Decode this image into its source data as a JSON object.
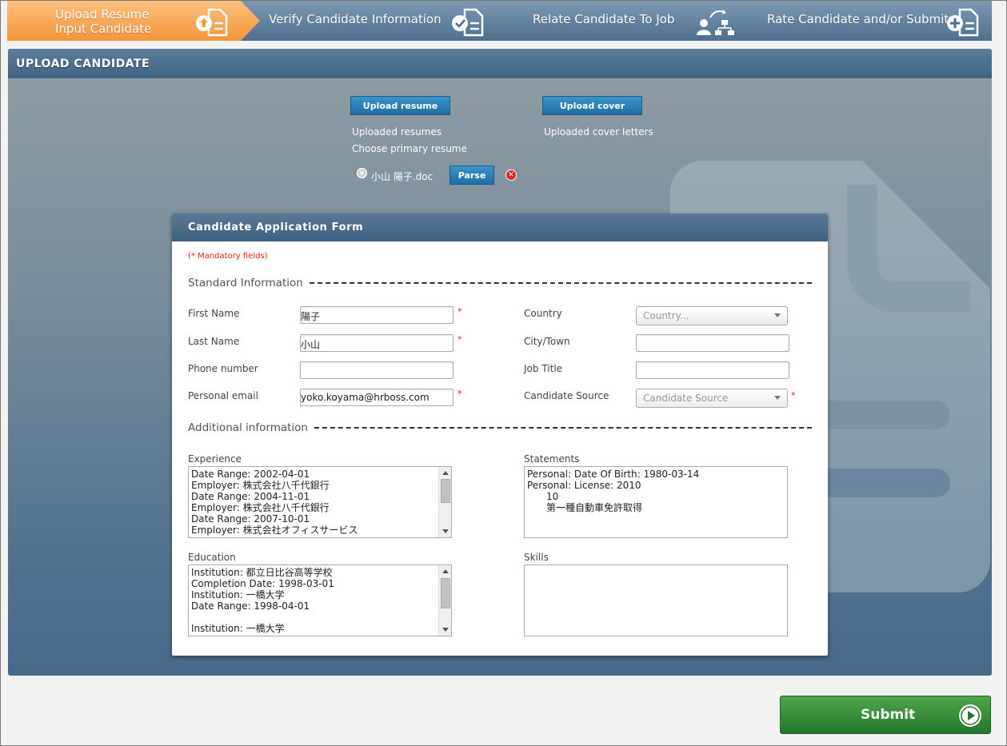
{
  "wizard": {
    "steps": [
      {
        "line1": "Upload Resume",
        "line2": "Input Candidate",
        "icon": "upload-document-icon",
        "active": true
      },
      {
        "line1": "Verify Candidate Information",
        "icon": "check-document-icon",
        "active": false
      },
      {
        "line1": "Relate Candidate To Job",
        "icon": "person-org-chart-icon",
        "active": false
      },
      {
        "line1": "Rate Candidate and/or Submit",
        "icon": "add-document-icon",
        "active": false
      }
    ]
  },
  "panel": {
    "title": "UPLOAD CANDIDATE",
    "upload_resume_button": "Upload resume",
    "upload_cover_button": "Upload cover",
    "uploaded_resumes_label": "Uploaded resumes",
    "choose_primary_label": "Choose primary resume",
    "uploaded_cover_label": "Uploaded cover letters",
    "resume_file": "小山 陽子.doc",
    "parse_button": "Parse",
    "remove_symbol": "✕"
  },
  "form": {
    "title": "Candidate Application Form",
    "mandatory_note": "(* Mandatory fields)",
    "required_mark": "*",
    "standard_section": "Standard Information",
    "additional_section": "Additional information",
    "fields": {
      "first_name": {
        "label": "First Name",
        "value": "陽子"
      },
      "last_name": {
        "label": "Last Name",
        "value": "小山"
      },
      "phone": {
        "label": "Phone number",
        "value": ""
      },
      "email": {
        "label": "Personal email",
        "value": "yoko.koyama@hrboss.com"
      },
      "country": {
        "label": "Country",
        "value": "Country..."
      },
      "city": {
        "label": "City/Town",
        "value": ""
      },
      "job_title": {
        "label": "Job Title",
        "value": ""
      },
      "source": {
        "label": "Candidate Source",
        "value": "Candidate Source"
      }
    },
    "experience": {
      "label": "Experience",
      "lines": [
        "Date Range: 2002-04-01",
        "Employer: 株式会社八千代銀行",
        "Date Range: 2004-11-01",
        "Employer: 株式会社八千代銀行",
        "Date Range: 2007-10-01",
        "Employer: 株式会社オフィスサービス"
      ]
    },
    "statements": {
      "label": "Statements",
      "lines": [
        "Personal: Date Of Birth: 1980-03-14",
        "Personal: License: 2010",
        "10",
        "第一種自動車免許取得"
      ]
    },
    "education": {
      "label": "Education",
      "lines": [
        "Institution: 都立日比谷高等学校",
        "Completion Date: 1998-03-01",
        "Institution: 一橋大学",
        "Date Range: 1998-04-01",
        "",
        "Institution: 一橋大学"
      ]
    },
    "skills": {
      "label": "Skills",
      "value": ""
    }
  },
  "submit_button": "Submit",
  "colors": {
    "active_step": "#f4953a",
    "step": "#5b7b99",
    "primary_button": "#1f6fa3",
    "submit": "#2e8a34",
    "required": "#dd2211"
  }
}
